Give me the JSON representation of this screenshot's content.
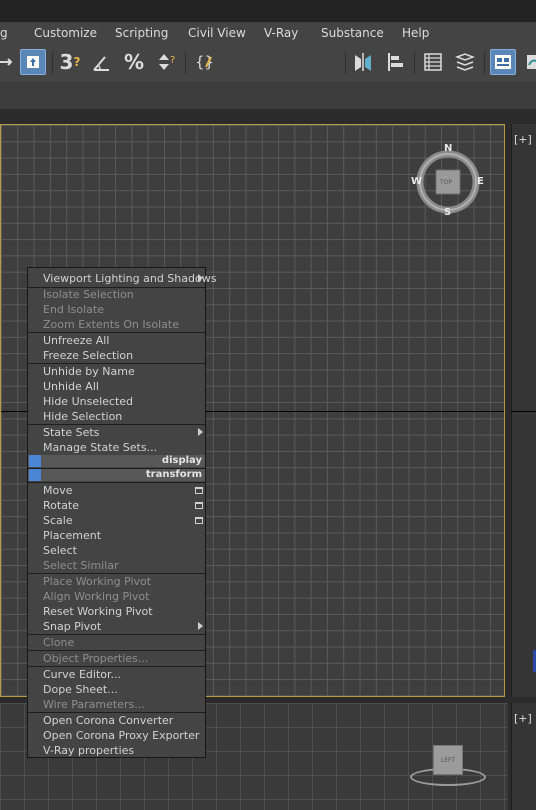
{
  "menubar": {
    "items": [
      "g",
      "Customize",
      "Scripting",
      "Civil View",
      "V-Ray",
      "Substance",
      "Help"
    ]
  },
  "toolbar": {
    "icons": [
      "move-icon",
      "select-object-icon",
      "snap-toggle-icon",
      "angle-snap-icon",
      "percent-snap-icon",
      "spinner-snap-icon",
      "edit-named-selection-icon",
      "named-selection-set-dropdown",
      "mirror-icon",
      "align-icon",
      "layer-explorer-icon",
      "toggle-layers-icon",
      "toggle-ribbon-icon"
    ],
    "snap_label": "3",
    "percent_label": "%",
    "named_set_value": ""
  },
  "viewports": {
    "top_right_label": "[+]",
    "bottom_right_label": "[+]",
    "compass": {
      "n": "N",
      "s": "S",
      "e": "E",
      "w": "W",
      "face": "TOP"
    },
    "left_cube_face": "LEFT"
  },
  "context_menu": {
    "items": [
      {
        "label": "Viewport Lighting and Shadows",
        "enabled": true,
        "submenu": true
      },
      {
        "label": "Isolate Selection",
        "enabled": false
      },
      {
        "label": "End Isolate",
        "enabled": false
      },
      {
        "label": "Zoom Extents On Isolate",
        "enabled": false
      },
      {
        "label": "Unfreeze All",
        "enabled": true
      },
      {
        "label": "Freeze Selection",
        "enabled": true
      },
      {
        "label": "Unhide by Name",
        "enabled": true
      },
      {
        "label": "Unhide All",
        "enabled": true
      },
      {
        "label": "Hide Unselected",
        "enabled": true
      },
      {
        "label": "Hide Selection",
        "enabled": true
      },
      {
        "label": "State Sets",
        "enabled": true,
        "submenu": true
      },
      {
        "label": "Manage State Sets...",
        "enabled": true
      },
      {
        "label": "Move",
        "enabled": true,
        "options": true
      },
      {
        "label": "Rotate",
        "enabled": true,
        "options": true
      },
      {
        "label": "Scale",
        "enabled": true,
        "options": true
      },
      {
        "label": "Placement",
        "enabled": true
      },
      {
        "label": "Select",
        "enabled": true
      },
      {
        "label": "Select Similar",
        "enabled": false
      },
      {
        "label": "Place Working Pivot",
        "enabled": false
      },
      {
        "label": "Align Working Pivot",
        "enabled": false
      },
      {
        "label": "Reset Working Pivot",
        "enabled": true
      },
      {
        "label": "Snap Pivot",
        "enabled": true,
        "submenu": true
      },
      {
        "label": "Clone",
        "enabled": false
      },
      {
        "label": "Object Properties...",
        "enabled": false
      },
      {
        "label": "Curve Editor...",
        "enabled": true
      },
      {
        "label": "Dope Sheet...",
        "enabled": true
      },
      {
        "label": "Wire Parameters...",
        "enabled": false
      },
      {
        "label": "Open Corona Converter",
        "enabled": true
      },
      {
        "label": "Open Corona Proxy Exporter",
        "enabled": true
      },
      {
        "label": "V-Ray properties",
        "enabled": true
      }
    ],
    "headers": {
      "display": "display",
      "transform": "transform"
    },
    "highlight_color": "#4a86d4"
  }
}
